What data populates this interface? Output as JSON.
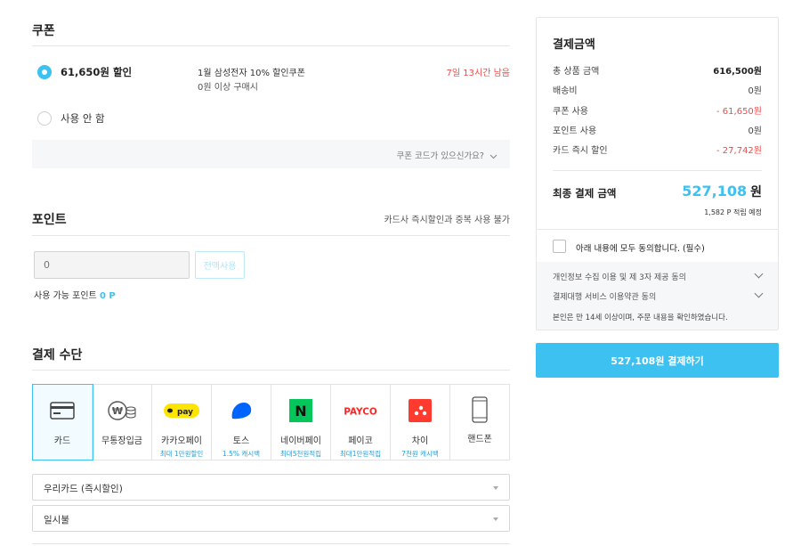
{
  "coupon": {
    "title": "쿠폰",
    "selected_label": "61,650원 할인",
    "coupon_name": "1월 삼성전자 10% 할인쿠폰",
    "coupon_condition": "0원 이상 구매시",
    "remaining": "7일 13시간 남음",
    "none_label": "사용 안 함",
    "code_link": "쿠폰 코드가 있으신가요?"
  },
  "point": {
    "title": "포인트",
    "note": "카드사 즉시할인과 중복 사용 불가",
    "input_placeholder": "0",
    "use_all_label": "전액사용",
    "available_label": "사용 가능 포인트",
    "available_value": "0 P"
  },
  "payment": {
    "title": "결제 수단",
    "methods": [
      {
        "label": "카드",
        "sub": "",
        "icon": "card-icon"
      },
      {
        "label": "무통장입금",
        "sub": "",
        "icon": "cash-icon"
      },
      {
        "label": "카카오페이",
        "sub": "최대 1만원할인",
        "icon": "kakaopay-icon",
        "logo": "pay"
      },
      {
        "label": "토스",
        "sub": "1.5% 캐시백",
        "icon": "toss-icon"
      },
      {
        "label": "네이버페이",
        "sub": "최대5천원적립",
        "icon": "naverpay-icon",
        "logo": "N"
      },
      {
        "label": "페이코",
        "sub": "최대1만원적립",
        "icon": "payco-icon",
        "logo": "PAYCO"
      },
      {
        "label": "차이",
        "sub": "7천원 캐시백",
        "icon": "chai-icon"
      },
      {
        "label": "핸드폰",
        "sub": "",
        "icon": "phone-icon"
      }
    ],
    "card_select": "우리카드 (즉시할인)",
    "installment_select": "일시불"
  },
  "summary": {
    "title": "결제금액",
    "rows": [
      {
        "label": "총 상품 금액",
        "value": "616,500원"
      },
      {
        "label": "배송비",
        "value": "0원"
      },
      {
        "label": "쿠폰 사용",
        "value": "- 61,650원"
      },
      {
        "label": "포인트 사용",
        "value": "0원"
      },
      {
        "label": "카드 즉시 할인",
        "value": "- 27,742원"
      }
    ],
    "final_label": "최종 결제 금액",
    "final_amount": "527,108",
    "final_unit": "원",
    "final_point": "1,582 P 적립 예정",
    "agree_all": "아래 내용에 모두 동의합니다. (필수)",
    "agree_items": [
      "개인정보 수집 이용 및 제 3자 제공 동의",
      "결제대행 서비스 이용약관 동의"
    ],
    "agree_note": "본인은 만 14세 이상이며, 주문 내용을 확인하였습니다.",
    "pay_button": "527,108원 결제하기"
  },
  "colors": {
    "accent": "#3cc1f0",
    "discount_red": "#ef4b4b",
    "kakao_yellow": "#fee500",
    "naver_green": "#03c75a",
    "payco_red": "#fa2828",
    "toss_blue": "#0064ff",
    "chai_red": "#ff3b30"
  }
}
